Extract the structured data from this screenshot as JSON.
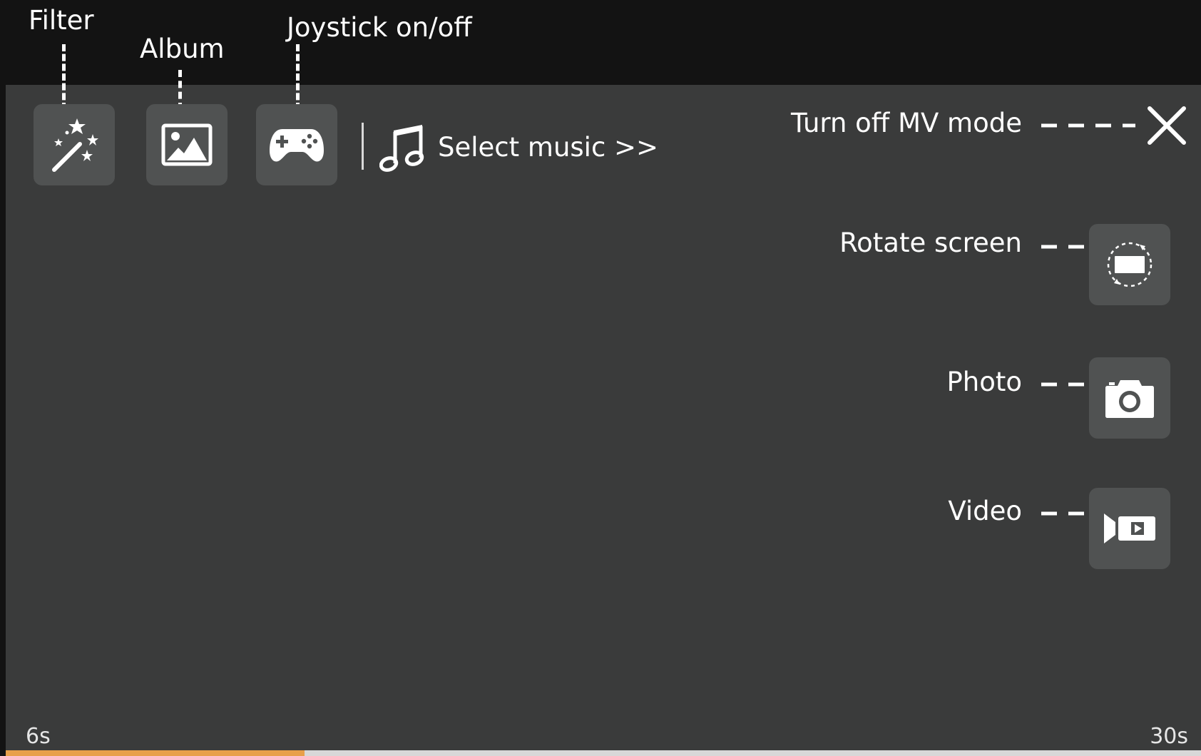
{
  "top_labels": {
    "filter": "Filter",
    "album": "Album",
    "joystick": "Joystick on/off"
  },
  "toolbar": {
    "select_music": "Select music >>"
  },
  "right_labels": {
    "turn_off_mv": "Turn off MV mode",
    "rotate_screen": "Rotate screen",
    "photo": "Photo",
    "video": "Video"
  },
  "timeline": {
    "min_label": "6s",
    "max_label": "30s",
    "progress_fraction": 0.25
  },
  "colors": {
    "background": "#131313",
    "panel": "#3a3b3b",
    "button": "#505252",
    "accent": "#e8a04a"
  },
  "icons": {
    "filter": "magic-wand-icon",
    "album": "image-icon",
    "joystick": "gamepad-icon",
    "music": "music-note-icon",
    "close": "close-icon",
    "rotate": "rotate-screen-icon",
    "photo": "camera-icon",
    "video": "video-camera-icon"
  }
}
